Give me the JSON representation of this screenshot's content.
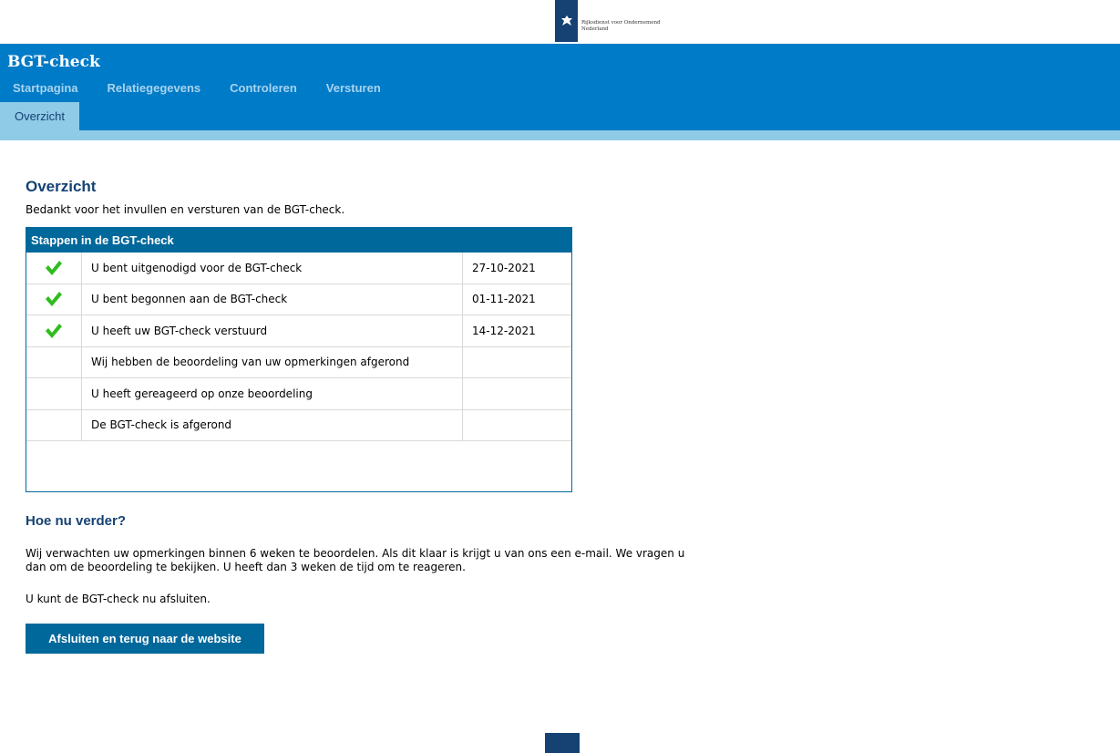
{
  "logo": {
    "line1": "Rijksdienst voor Ondernemend",
    "line2": "Nederland"
  },
  "header": {
    "app_title": "BGT-check",
    "nav": [
      "Startpagina",
      "Relatiegegevens",
      "Controleren",
      "Versturen"
    ],
    "active_subtab": "Overzicht"
  },
  "main": {
    "title": "Overzicht",
    "intro": "Bedankt voor het invullen en versturen van de BGT-check.",
    "steps": {
      "header": "Stappen in de BGT-check",
      "rows": [
        {
          "done": true,
          "label": "U bent uitgenodigd voor de BGT-check",
          "date": "27-10-2021"
        },
        {
          "done": true,
          "label": "U bent begonnen aan de BGT-check",
          "date": "01-11-2021"
        },
        {
          "done": true,
          "label": "U heeft uw BGT-check verstuurd",
          "date": "14-12-2021"
        },
        {
          "done": false,
          "label": "Wij hebben de beoordeling van uw opmerkingen afgerond",
          "date": ""
        },
        {
          "done": false,
          "label": "U heeft gereageerd op onze beoordeling",
          "date": ""
        },
        {
          "done": false,
          "label": "De BGT-check is afgerond",
          "date": ""
        }
      ]
    },
    "next": {
      "title": "Hoe nu verder?",
      "paragraph": "Wij verwachten uw opmerkingen binnen 6 weken te beoordelen. Als dit klaar is krijgt u van ons een e-mail. We vragen u dan om de beoordeling te bekijken. U heeft dan 3 weken de tijd om te reageren.",
      "closing": "U kunt de BGT-check nu afsluiten.",
      "button": "Afsluiten en terug naar de website"
    }
  },
  "colors": {
    "header_blue": "#007bc7",
    "light_blue": "#8fcae7",
    "dark_blue": "#154273",
    "table_blue": "#01689b",
    "check_green": "#2ebd1c"
  }
}
